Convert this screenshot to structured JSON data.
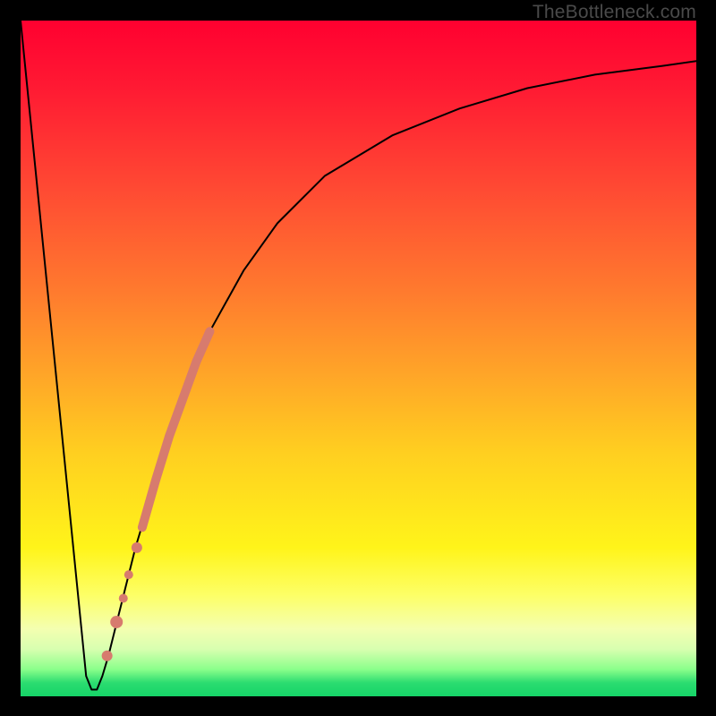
{
  "attribution": "TheBottleneck.com",
  "chart_data": {
    "type": "line",
    "title": "",
    "xlabel": "",
    "ylabel": "",
    "xlim": [
      0,
      100
    ],
    "ylim": [
      0,
      100
    ],
    "grid": false,
    "legend": false,
    "background_gradient": {
      "direction": "vertical",
      "stops": [
        {
          "pos": 0.0,
          "color": "#ff0030"
        },
        {
          "pos": 0.4,
          "color": "#ff7a2e"
        },
        {
          "pos": 0.78,
          "color": "#fff41a"
        },
        {
          "pos": 0.93,
          "color": "#d8ffb0"
        },
        {
          "pos": 1.0,
          "color": "#16d468"
        }
      ]
    },
    "series": [
      {
        "name": "bottleneck-curve",
        "stroke": "#000000",
        "stroke_width": 2,
        "x": [
          0.0,
          2.0,
          4.0,
          6.0,
          8.0,
          9.0,
          9.7,
          10.5,
          11.3,
          12.1,
          13.0,
          15.0,
          17.0,
          20.0,
          24.0,
          28.0,
          33.0,
          38.0,
          45.0,
          55.0,
          65.0,
          75.0,
          85.0,
          95.0,
          100.0
        ],
        "y": [
          100.0,
          80.0,
          60.0,
          40.0,
          20.0,
          10.0,
          3.0,
          1.0,
          1.0,
          3.0,
          6.0,
          14.0,
          22.0,
          32.0,
          44.0,
          54.0,
          63.0,
          70.0,
          77.0,
          83.0,
          87.0,
          90.0,
          92.0,
          93.3,
          94.0
        ]
      },
      {
        "name": "highlight-band",
        "stroke": "#d77b6e",
        "stroke_width": 10,
        "x": [
          18.0,
          20.0,
          22.0,
          24.0,
          26.0,
          28.0
        ],
        "y": [
          25.0,
          32.0,
          38.5,
          44.0,
          49.5,
          54.0
        ]
      },
      {
        "name": "highlight-dots",
        "type": "scatter",
        "color": "#d77b6e",
        "points": [
          {
            "x": 17.2,
            "y": 22.0,
            "r": 6
          },
          {
            "x": 16.0,
            "y": 18.0,
            "r": 5
          },
          {
            "x": 15.2,
            "y": 14.5,
            "r": 5
          },
          {
            "x": 14.2,
            "y": 11.0,
            "r": 7
          },
          {
            "x": 12.8,
            "y": 6.0,
            "r": 6
          }
        ]
      }
    ]
  }
}
